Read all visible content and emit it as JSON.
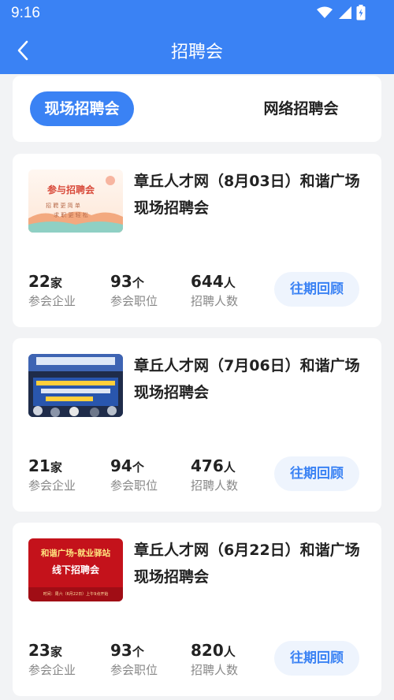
{
  "status": {
    "time": "9:16"
  },
  "navbar": {
    "title": "招聘会"
  },
  "tabs": {
    "active": "现场招聘会",
    "inactive": "网络招聘会"
  },
  "labels": {
    "companies": "参会企业",
    "positions": "参会职位",
    "recruits": "招聘人数",
    "review": "往期回顾"
  },
  "units": {
    "companies": "家",
    "positions": "个",
    "recruits": "人"
  },
  "events": [
    {
      "title": "章丘人才网（8月03日）和谐广场现场招聘会",
      "companies": "22",
      "positions": "93",
      "recruits": "644",
      "thumb": {
        "line1": "参与招聘会",
        "line2": "招 聘 更 简 单",
        "line3": "求 职 更 轻 松"
      }
    },
    {
      "title": "章丘人才网（7月06日）和谐广场现场招聘会",
      "companies": "21",
      "positions": "94",
      "recruits": "476",
      "thumb": {}
    },
    {
      "title": "章丘人才网（6月22日）和谐广场现场招聘会",
      "companies": "23",
      "positions": "93",
      "recruits": "820",
      "thumb": {
        "line1": "和谐广场-就业驿站",
        "line2": "线下招聘会",
        "line3": "时间：周六（6月22日）上午9点开始"
      }
    }
  ],
  "colors": {
    "primary": "#3a82f4",
    "background": "#f2f3f5"
  }
}
